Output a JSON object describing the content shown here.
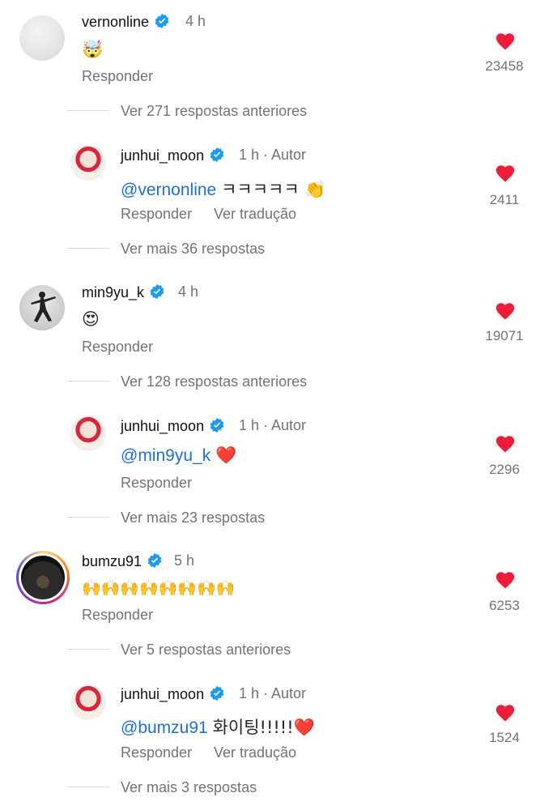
{
  "comments": [
    {
      "username": "vernonline",
      "time": "4 h",
      "body_emoji": "🤯",
      "reply_label": "Responder",
      "likes": "23458",
      "more_replies": "Ver 271 respostas anteriores"
    },
    {
      "username": "junhui_moon",
      "time": "1 h · Autor",
      "mention": "@vernonline",
      "body_text": "ㅋㅋㅋㅋㅋ 👏",
      "reply_label": "Responder",
      "translate_label": "Ver tradução",
      "likes": "2411",
      "more_replies": "Ver mais 36 respostas"
    },
    {
      "username": "min9yu_k",
      "time": "4 h",
      "body_emoji": "😍",
      "reply_label": "Responder",
      "likes": "19071",
      "more_replies": "Ver 128 respostas anteriores"
    },
    {
      "username": "junhui_moon",
      "time": "1 h · Autor",
      "mention": "@min9yu_k",
      "body_text": "❤️",
      "reply_label": "Responder",
      "likes": "2296",
      "more_replies": "Ver mais 23 respostas"
    },
    {
      "username": "bumzu91",
      "time": "5 h",
      "body_emoji": "🙌🙌🙌🙌🙌🙌🙌🙌",
      "reply_label": "Responder",
      "likes": "6253",
      "more_replies": "Ver 5 respostas anteriores"
    },
    {
      "username": "junhui_moon",
      "time": "1 h · Autor",
      "mention": "@bumzu91",
      "body_text": "화이팅!!!!!❤️",
      "reply_label": "Responder",
      "translate_label": "Ver tradução",
      "likes": "1524",
      "more_replies": "Ver mais 3 respostas"
    }
  ],
  "colors": {
    "heart": "#ed1c3a",
    "verified": "#1d9bf0",
    "mention": "#1f6fd0",
    "muted": "#737373"
  },
  "icons": {
    "like": "heart-icon",
    "verified": "verified-badge-icon"
  }
}
